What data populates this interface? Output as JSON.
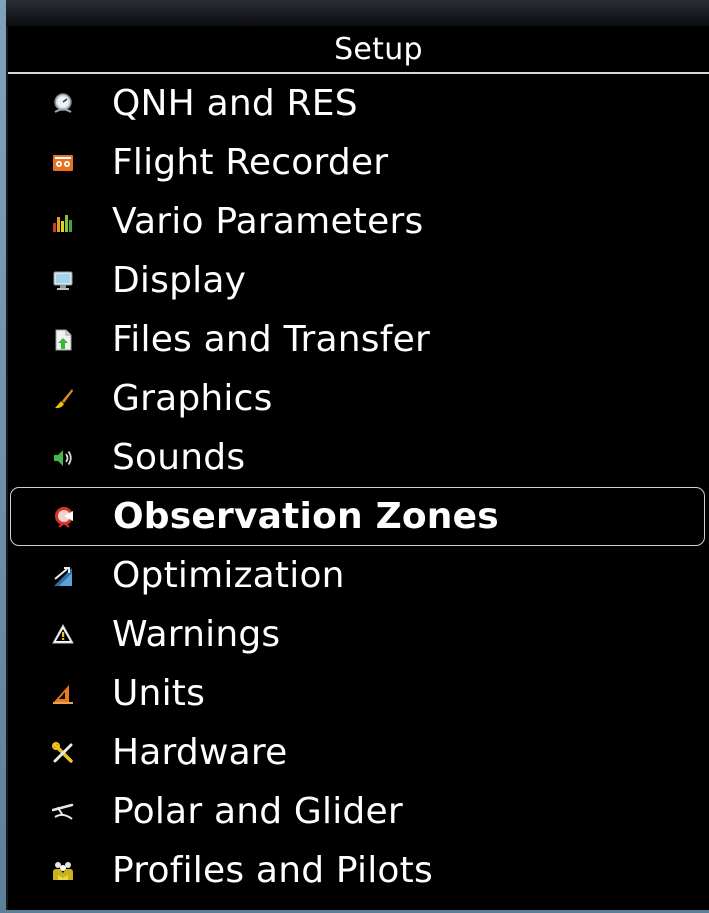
{
  "window": {
    "title": "Setup"
  },
  "menu": {
    "items": [
      {
        "label": "QNH and RES",
        "icon": "altimeter-icon",
        "selected": false
      },
      {
        "label": "Flight Recorder",
        "icon": "flight-recorder-icon",
        "selected": false
      },
      {
        "label": "Vario Parameters",
        "icon": "vario-bars-icon",
        "selected": false
      },
      {
        "label": "Display",
        "icon": "monitor-icon",
        "selected": false
      },
      {
        "label": "Files and Transfer",
        "icon": "file-transfer-icon",
        "selected": false
      },
      {
        "label": "Graphics",
        "icon": "paintbrush-icon",
        "selected": false
      },
      {
        "label": "Sounds",
        "icon": "speaker-icon",
        "selected": false
      },
      {
        "label": "Observation Zones",
        "icon": "observation-zone-icon",
        "selected": true
      },
      {
        "label": "Optimization",
        "icon": "optimization-icon",
        "selected": false
      },
      {
        "label": "Warnings",
        "icon": "warning-icon",
        "selected": false
      },
      {
        "label": "Units",
        "icon": "set-square-icon",
        "selected": false
      },
      {
        "label": "Hardware",
        "icon": "tools-icon",
        "selected": false
      },
      {
        "label": "Polar and Glider",
        "icon": "glider-icon",
        "selected": false
      },
      {
        "label": "Profiles and Pilots",
        "icon": "pilots-icon",
        "selected": false
      }
    ]
  },
  "colors": {
    "background": "#000000",
    "text": "#ffffff",
    "selection_border": "#cfcfcf",
    "divider": "#d8d8d8"
  }
}
